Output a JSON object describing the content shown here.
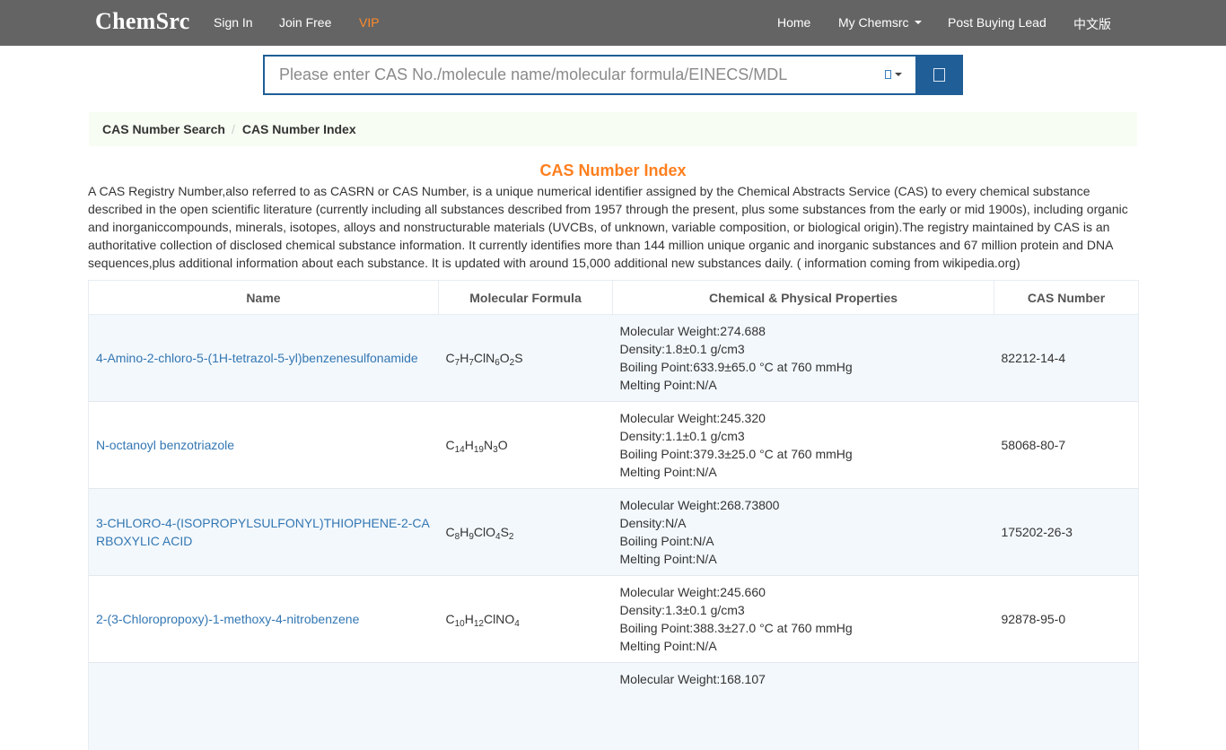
{
  "header": {
    "brand": "ChemSrc",
    "sign_in": "Sign In",
    "join_free": "Join Free",
    "vip": "VIP",
    "home": "Home",
    "my_chemsrc": "My Chemsrc",
    "post_buying_lead": "Post Buying Lead",
    "chinese": "中文版",
    "colors": {
      "bar": "#646464",
      "vip": "#ff8a2a"
    }
  },
  "search": {
    "placeholder": "Please enter CAS No./molecule name/molecular formula/EINECS/MDL",
    "value": "",
    "type_icon": "search-type-icon",
    "button_icon": "search-icon"
  },
  "breadcrumb": {
    "items": [
      "CAS Number Search",
      "CAS Number Index"
    ],
    "separator": "/"
  },
  "page": {
    "title": "CAS Number Index",
    "description": "A CAS Registry Number,also referred to as CASRN or CAS Number, is a unique numerical identifier assigned by the Chemical Abstracts Service (CAS) to every chemical substance described in the open scientific literature (currently including all substances described from 1957 through the present, plus some substances from the early or mid 1900s), including organic and inorganiccompounds, minerals, isotopes, alloys and nonstructurable materials (UVCBs, of unknown, variable composition, or biological origin).The registry maintained by CAS is an authoritative collection of disclosed chemical substance information. It currently identifies more than 144 million unique organic and inorganic substances and 67 million protein and DNA sequences,plus additional information about each substance. It is updated with around 15,000 additional new substances daily. ( information coming from wikipedia.org)",
    "title_color": "#ff7f1e"
  },
  "table": {
    "columns": [
      "Name",
      "Molecular Formula",
      "Chemical & Physical Properties",
      "CAS Number"
    ],
    "rows": [
      {
        "name": "4-Amino-2-chloro-5-(1H-tetrazol-5-yl)benzenesulfonamide",
        "formula": [
          [
            "C",
            "7"
          ],
          [
            "H",
            "7"
          ],
          [
            "ClN",
            "6"
          ],
          [
            "O",
            "2"
          ],
          [
            "S",
            ""
          ]
        ],
        "mw": "Molecular Weight:274.688",
        "density": "Density:1.8±0.1 g/cm3",
        "bp": "Boiling Point:633.9±65.0 °C at 760 mmHg",
        "mp": "Melting Point:N/A",
        "cas": "82212-14-4"
      },
      {
        "name": "N-octanoyl benzotriazole",
        "formula": [
          [
            "C",
            "14"
          ],
          [
            "H",
            "19"
          ],
          [
            "N",
            "3"
          ],
          [
            "O",
            ""
          ]
        ],
        "mw": "Molecular Weight:245.320",
        "density": "Density:1.1±0.1 g/cm3",
        "bp": "Boiling Point:379.3±25.0 °C at 760 mmHg",
        "mp": "Melting Point:N/A",
        "cas": "58068-80-7"
      },
      {
        "name": "3-CHLORO-4-(ISOPROPYLSULFONYL)THIOPHENE-2-CARBOXYLIC ACID",
        "formula": [
          [
            "C",
            "8"
          ],
          [
            "H",
            "9"
          ],
          [
            "ClO",
            "4"
          ],
          [
            "S",
            "2"
          ]
        ],
        "mw": "Molecular Weight:268.73800",
        "density": "Density:N/A",
        "bp": "Boiling Point:N/A",
        "mp": "Melting Point:N/A",
        "cas": "175202-26-3"
      },
      {
        "name": "2-(3-Chloropropoxy)-1-methoxy-4-nitrobenzene",
        "formula": [
          [
            "C",
            "10"
          ],
          [
            "H",
            "12"
          ],
          [
            "ClNO",
            "4"
          ]
        ],
        "mw": "Molecular Weight:245.660",
        "density": "Density:1.3±0.1 g/cm3",
        "bp": "Boiling Point:388.3±27.0 °C at 760 mmHg",
        "mp": "Melting Point:N/A",
        "cas": "92878-95-0"
      },
      {
        "name": "",
        "formula": [],
        "mw": "Molecular Weight:168.107",
        "density": "",
        "bp": "",
        "mp": "",
        "cas": ""
      }
    ]
  }
}
